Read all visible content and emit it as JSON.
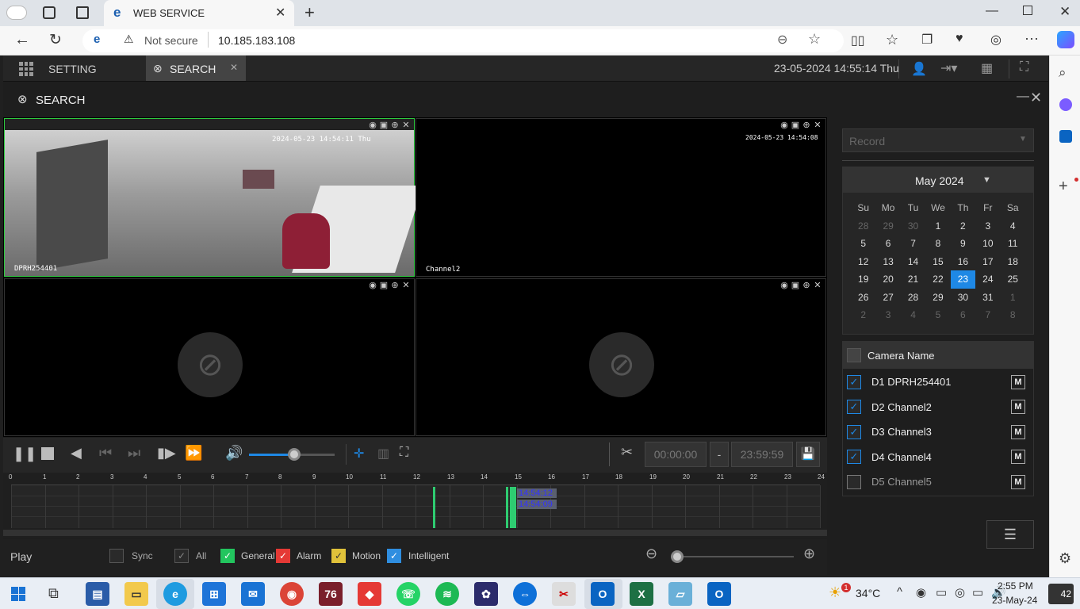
{
  "browser": {
    "tab_title": "WEB SERVICE",
    "address": "10.185.183.108",
    "security": "Not secure"
  },
  "app": {
    "nav": {
      "setting": "SETTING",
      "search": "SEARCH"
    },
    "datetime": "23-05-2024 14:55:14 Thu",
    "panel_title": "SEARCH",
    "record_type": "Record",
    "calendar": {
      "month": "May 2024",
      "weekdays": [
        "Su",
        "Mo",
        "Tu",
        "We",
        "Th",
        "Fr",
        "Sa"
      ],
      "weeks": [
        [
          "28",
          "29",
          "30",
          "1",
          "2",
          "3",
          "4"
        ],
        [
          "5",
          "6",
          "7",
          "8",
          "9",
          "10",
          "11"
        ],
        [
          "12",
          "13",
          "14",
          "15",
          "16",
          "17",
          "18"
        ],
        [
          "19",
          "20",
          "21",
          "22",
          "23",
          "24",
          "25"
        ],
        [
          "26",
          "27",
          "28",
          "29",
          "30",
          "31",
          "1"
        ],
        [
          "2",
          "3",
          "4",
          "5",
          "6",
          "7",
          "8"
        ]
      ],
      "selected": "23"
    },
    "camera_header": "Camera Name",
    "cameras": [
      {
        "label": "D1 DPRH254401",
        "checked": true,
        "m": "M"
      },
      {
        "label": "D2 Channel2",
        "checked": true,
        "m": "M"
      },
      {
        "label": "D3 Channel3",
        "checked": true,
        "m": "M"
      },
      {
        "label": "D4 Channel4",
        "checked": true,
        "m": "M"
      },
      {
        "label": "D5 Channel5",
        "checked": false,
        "m": "M"
      }
    ],
    "videos": {
      "v1_time": "2024-05-23 14:54:11 Thu",
      "v1_name": "DPRH254401",
      "v2_time": "2024-05-23 14:54:08",
      "v2_name": "Channel2"
    },
    "clip": {
      "start": "00:00:00",
      "dash": "-",
      "end": "23:59:59"
    },
    "timeline": {
      "hours": [
        "0",
        "1",
        "2",
        "3",
        "4",
        "5",
        "6",
        "7",
        "8",
        "9",
        "10",
        "11",
        "12",
        "13",
        "14",
        "15",
        "16",
        "17",
        "18",
        "19",
        "20",
        "21",
        "22",
        "23",
        "24"
      ],
      "marker1": "14:54:12",
      "marker2": "14:54:09"
    },
    "legend": {
      "play": "Play",
      "sync": "Sync",
      "all": "All",
      "general": "General",
      "alarm": "Alarm",
      "motion": "Motion",
      "intelligent": "Intelligent"
    }
  },
  "taskbar": {
    "temp": "34°C",
    "time": "2:55 PM",
    "date": "23-May-24",
    "badge": "42"
  },
  "colors": {
    "accent": "#1e88e5",
    "green": "#22c55e",
    "red": "#e53935",
    "yellow": "#e0c23a",
    "blue": "#2f8ee0"
  }
}
